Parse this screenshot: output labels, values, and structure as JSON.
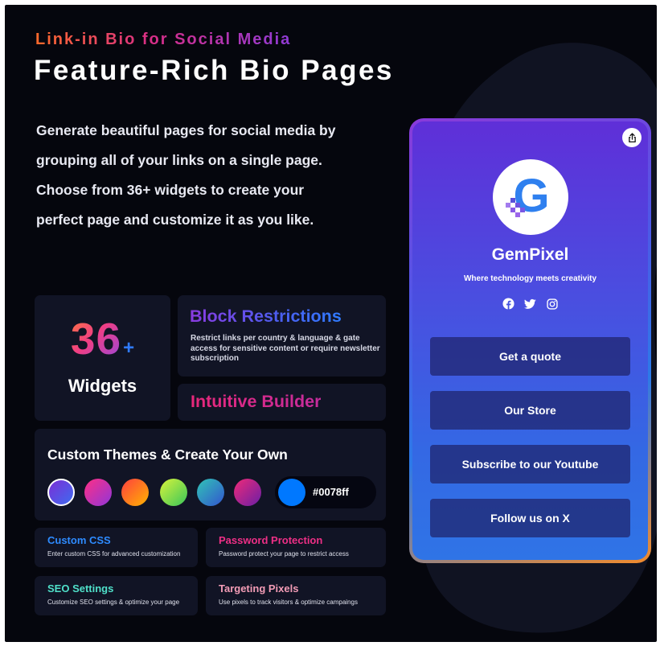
{
  "hero": {
    "eyebrow": "Link-in Bio for Social Media",
    "title": "Feature-Rich Bio Pages",
    "intro": "Generate beautiful pages for social media by grouping all of your links on a single page. Choose from 36+ widgets to create your perfect page and customize it as you like."
  },
  "widgets": {
    "number": "36",
    "plus": "+",
    "label": "Widgets"
  },
  "block_restrictions": {
    "title": "Block Restrictions",
    "description": "Restrict links per country & language & gate access for sensitive content or require newsletter subscription"
  },
  "intuitive_builder": {
    "title": "Intuitive Builder"
  },
  "themes": {
    "title": "Custom Themes & Create Your Own",
    "swatches": [
      {
        "name": "purple-blue",
        "colors": [
          "#7b2fd6",
          "#3e6bf0"
        ],
        "selected": true
      },
      {
        "name": "pink-purple",
        "colors": [
          "#ff2f85",
          "#8f36d9"
        ],
        "selected": false
      },
      {
        "name": "orange",
        "colors": [
          "#ff3f3f",
          "#ffb400"
        ],
        "selected": false
      },
      {
        "name": "lime-green",
        "colors": [
          "#d9f33b",
          "#39c65a"
        ],
        "selected": false
      },
      {
        "name": "teal-blue",
        "colors": [
          "#31c4b6",
          "#3255cf"
        ],
        "selected": false
      },
      {
        "name": "magenta-purple",
        "colors": [
          "#ef2a78",
          "#6a1fa6"
        ],
        "selected": false
      }
    ],
    "custom_color": "#0078ff"
  },
  "features": [
    {
      "title": "Custom CSS",
      "description": "Enter custom CSS for advanced customization",
      "color": "#2e8bff"
    },
    {
      "title": "Password Protection",
      "description": "Password protect your page to restrict access",
      "color": "#ee2f86"
    },
    {
      "title": "SEO Settings",
      "description": "Customize SEO settings & optimize your page",
      "color": "#4fe0c9"
    },
    {
      "title": "Targeting Pixels",
      "description": "Use pixels to track visitors & optimize campaings",
      "color": "#f39cb6"
    }
  ],
  "preview": {
    "name": "GemPixel",
    "tagline": "Where technology meets creativity",
    "logo_letter": "G",
    "social_icons": [
      "facebook-icon",
      "twitter-icon",
      "instagram-icon"
    ],
    "links": [
      "Get a quote",
      "Our Store",
      "Subscribe to our Youtube",
      "Follow us on X"
    ]
  }
}
